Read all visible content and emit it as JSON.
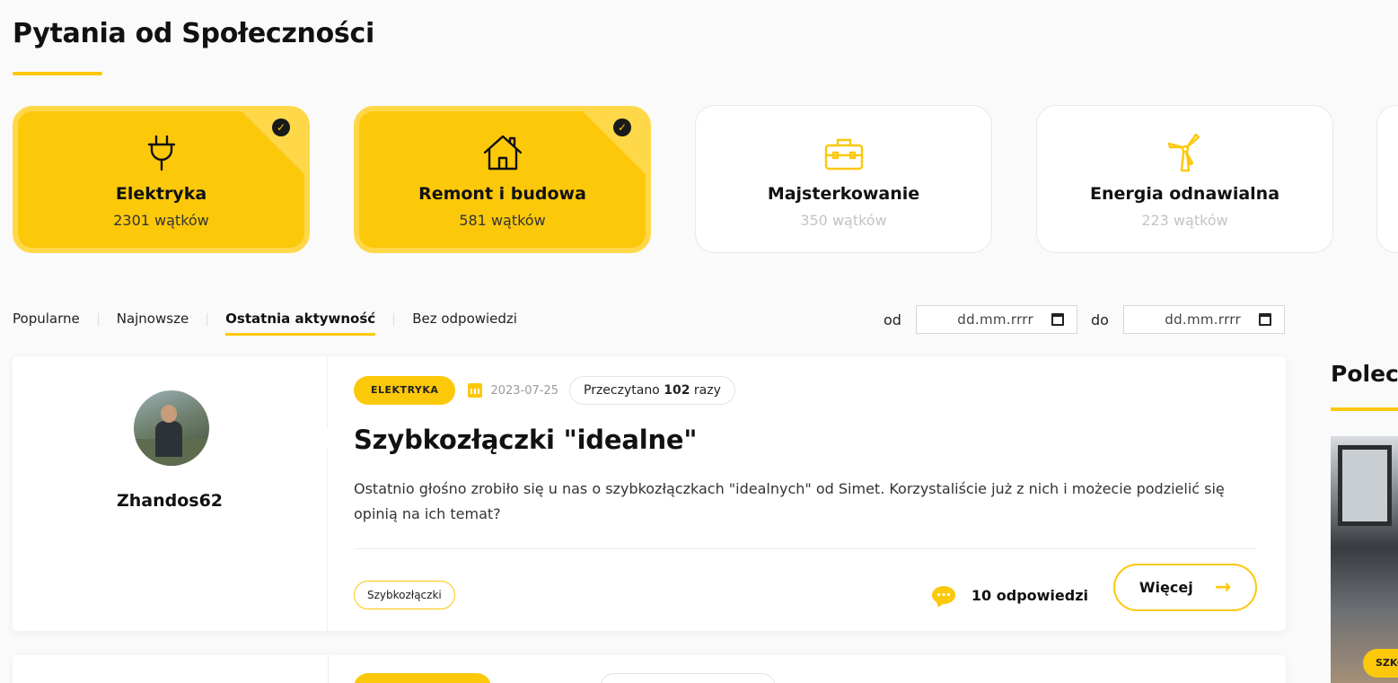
{
  "page": {
    "title": "Pytania od Społeczności"
  },
  "categories": [
    {
      "name": "Elektryka",
      "count": "2301 wątków",
      "active": true,
      "icon": "plug-icon"
    },
    {
      "name": "Remont i budowa",
      "count": "581 wątków",
      "active": true,
      "icon": "house-icon"
    },
    {
      "name": "Majsterkowanie",
      "count": "350 wątków",
      "active": false,
      "icon": "toolbox-icon"
    },
    {
      "name": "Energia odnawialna",
      "count": "223 wątków",
      "active": false,
      "icon": "wind-turbine-icon"
    }
  ],
  "tabs": [
    {
      "label": "Popularne",
      "active": false
    },
    {
      "label": "Najnowsze",
      "active": false
    },
    {
      "label": "Ostatnia aktywność",
      "active": true
    },
    {
      "label": "Bez odpowiedzi",
      "active": false
    }
  ],
  "filter": {
    "from_label": "od",
    "to_label": "do",
    "from_placeholder": "dd.mm.rrrr",
    "to_placeholder": "dd.mm.rrrr"
  },
  "question": {
    "author": "Zhandos62",
    "category": "ELEKTRYKA",
    "date": "2023-07-25",
    "read_prefix": "Przeczytano",
    "read_count": "102",
    "read_suffix": "razy",
    "title": "Szybkozłączki \"idealne\"",
    "excerpt": "Ostatnio głośno zrobiło się u nas o szybkozłączkach \"idealnych\" od Simet. Korzystaliście już z nich i możecie podzielić się opinią na ich temat?",
    "tag": "Szybkozłączki",
    "answers": "10 odpowiedzi",
    "more_label": "Więcej"
  },
  "sidebar": {
    "title": "Polecane",
    "pill": "SZKOLENIA"
  },
  "colors": {
    "accent": "#fcc80a",
    "accent_light": "#ffd84a",
    "text": "#111111",
    "muted": "#c4c4c4"
  }
}
